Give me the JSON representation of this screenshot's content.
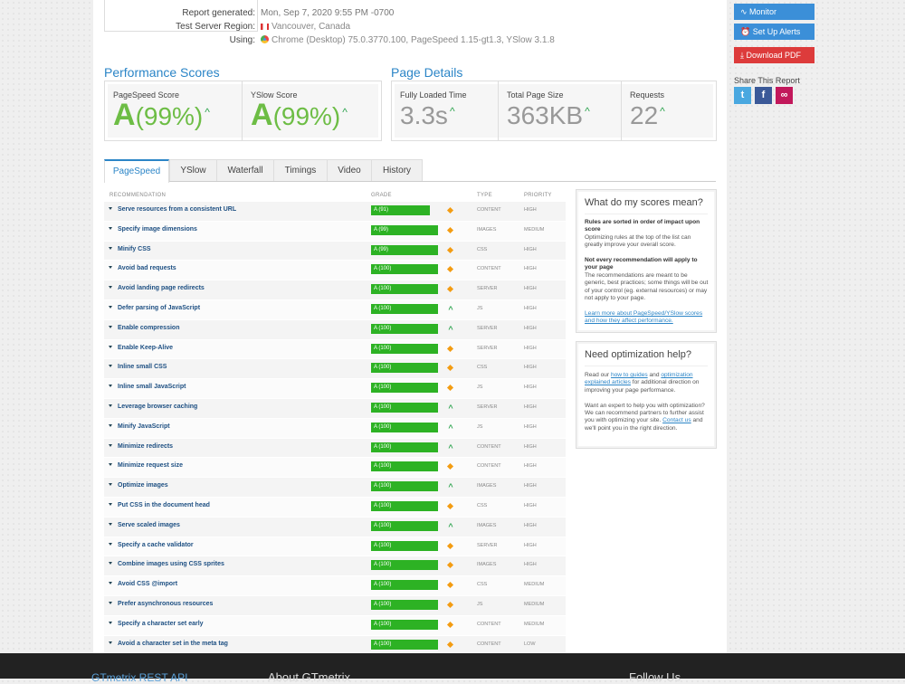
{
  "report": {
    "generated_label": "Report generated:",
    "generated_value": "Mon, Sep 7, 2020 9:55 PM -0700",
    "region_label": "Test Server Region:",
    "region_value": "Vancouver, Canada",
    "using_label": "Using:",
    "using_value": "Chrome (Desktop) 75.0.3770.100, PageSpeed 1.15-gt1.3, YSlow 3.1.8"
  },
  "performance": {
    "title": "Performance Scores",
    "pagespeed_label": "PageSpeed Score",
    "pagespeed_grade": "A",
    "pagespeed_pct": "(99%)",
    "yslow_label": "YSlow Score",
    "yslow_grade": "A",
    "yslow_pct": "(99%)"
  },
  "details": {
    "title": "Page Details",
    "loaded_label": "Fully Loaded Time",
    "loaded_value": "3.3s",
    "size_label": "Total Page Size",
    "size_value": "363KB",
    "requests_label": "Requests",
    "requests_value": "22"
  },
  "tabs": [
    "PageSpeed",
    "YSlow",
    "Waterfall",
    "Timings",
    "Video",
    "History"
  ],
  "table_head": {
    "rec": "RECOMMENDATION",
    "grade": "GRADE",
    "type": "TYPE",
    "priority": "PRIORITY"
  },
  "recommendations": [
    {
      "name": "Serve resources from a consistent URL",
      "grade": "A (91)",
      "ind": "diamond",
      "type": "CONTENT",
      "priority": "HIGH"
    },
    {
      "name": "Specify image dimensions",
      "grade": "A (99)",
      "ind": "diamond",
      "type": "IMAGES",
      "priority": "MEDIUM"
    },
    {
      "name": "Minify CSS",
      "grade": "A (99)",
      "ind": "diamond",
      "type": "CSS",
      "priority": "HIGH"
    },
    {
      "name": "Avoid bad requests",
      "grade": "A (100)",
      "ind": "diamond",
      "type": "CONTENT",
      "priority": "HIGH"
    },
    {
      "name": "Avoid landing page redirects",
      "grade": "A (100)",
      "ind": "diamond",
      "type": "SERVER",
      "priority": "HIGH"
    },
    {
      "name": "Defer parsing of JavaScript",
      "grade": "A (100)",
      "ind": "arrow",
      "type": "JS",
      "priority": "HIGH"
    },
    {
      "name": "Enable compression",
      "grade": "A (100)",
      "ind": "arrow",
      "type": "SERVER",
      "priority": "HIGH"
    },
    {
      "name": "Enable Keep-Alive",
      "grade": "A (100)",
      "ind": "diamond",
      "type": "SERVER",
      "priority": "HIGH"
    },
    {
      "name": "Inline small CSS",
      "grade": "A (100)",
      "ind": "diamond",
      "type": "CSS",
      "priority": "HIGH"
    },
    {
      "name": "Inline small JavaScript",
      "grade": "A (100)",
      "ind": "diamond",
      "type": "JS",
      "priority": "HIGH"
    },
    {
      "name": "Leverage browser caching",
      "grade": "A (100)",
      "ind": "arrow",
      "type": "SERVER",
      "priority": "HIGH"
    },
    {
      "name": "Minify JavaScript",
      "grade": "A (100)",
      "ind": "arrow",
      "type": "JS",
      "priority": "HIGH"
    },
    {
      "name": "Minimize redirects",
      "grade": "A (100)",
      "ind": "arrow",
      "type": "CONTENT",
      "priority": "HIGH"
    },
    {
      "name": "Minimize request size",
      "grade": "A (100)",
      "ind": "diamond",
      "type": "CONTENT",
      "priority": "HIGH"
    },
    {
      "name": "Optimize images",
      "grade": "A (100)",
      "ind": "arrow",
      "type": "IMAGES",
      "priority": "HIGH"
    },
    {
      "name": "Put CSS in the document head",
      "grade": "A (100)",
      "ind": "diamond",
      "type": "CSS",
      "priority": "HIGH"
    },
    {
      "name": "Serve scaled images",
      "grade": "A (100)",
      "ind": "arrow",
      "type": "IMAGES",
      "priority": "HIGH"
    },
    {
      "name": "Specify a cache validator",
      "grade": "A (100)",
      "ind": "diamond",
      "type": "SERVER",
      "priority": "HIGH"
    },
    {
      "name": "Combine images using CSS sprites",
      "grade": "A (100)",
      "ind": "diamond",
      "type": "IMAGES",
      "priority": "HIGH"
    },
    {
      "name": "Avoid CSS @import",
      "grade": "A (100)",
      "ind": "diamond",
      "type": "CSS",
      "priority": "MEDIUM"
    },
    {
      "name": "Prefer asynchronous resources",
      "grade": "A (100)",
      "ind": "diamond",
      "type": "JS",
      "priority": "MEDIUM"
    },
    {
      "name": "Specify a character set early",
      "grade": "A (100)",
      "ind": "diamond",
      "type": "CONTENT",
      "priority": "MEDIUM"
    },
    {
      "name": "Avoid a character set in the meta tag",
      "grade": "A (100)",
      "ind": "diamond",
      "type": "CONTENT",
      "priority": "LOW"
    }
  ],
  "sidebar": {
    "monitor": "Monitor",
    "alerts": "Set Up Alerts",
    "pdf": "Download PDF",
    "share_label": "Share This Report"
  },
  "scores_box": {
    "title": "What do my scores mean?",
    "b1": "Rules are sorted in order of impact upon score",
    "t1": "Optimizing rules at the top of the list can greatly improve your overall score.",
    "b2": "Not every recommendation will apply to your page",
    "t2": "The recommendations are meant to be generic, best practices; some things will be out of your control (eg. external resources) or may not apply to your page.",
    "link": "Learn more about PageSpeed/YSlow scores and how they affect performance."
  },
  "help_box": {
    "title": "Need optimization help?",
    "p1a": "Read our ",
    "p1link1": "how to guides",
    "p1b": " and ",
    "p1link2": "optimization explained articles",
    "p1c": " for additional direction on improving your page performance.",
    "p2a": "Want an expert to help you with optimization? We can recommend partners to further assist you with optimizing your site. ",
    "p2link": "Contact us",
    "p2b": " and we'll point you in the right direction."
  },
  "footer": {
    "api": "GTmetrix REST API",
    "about": "About GTmetrix",
    "follow": "Follow Us"
  }
}
